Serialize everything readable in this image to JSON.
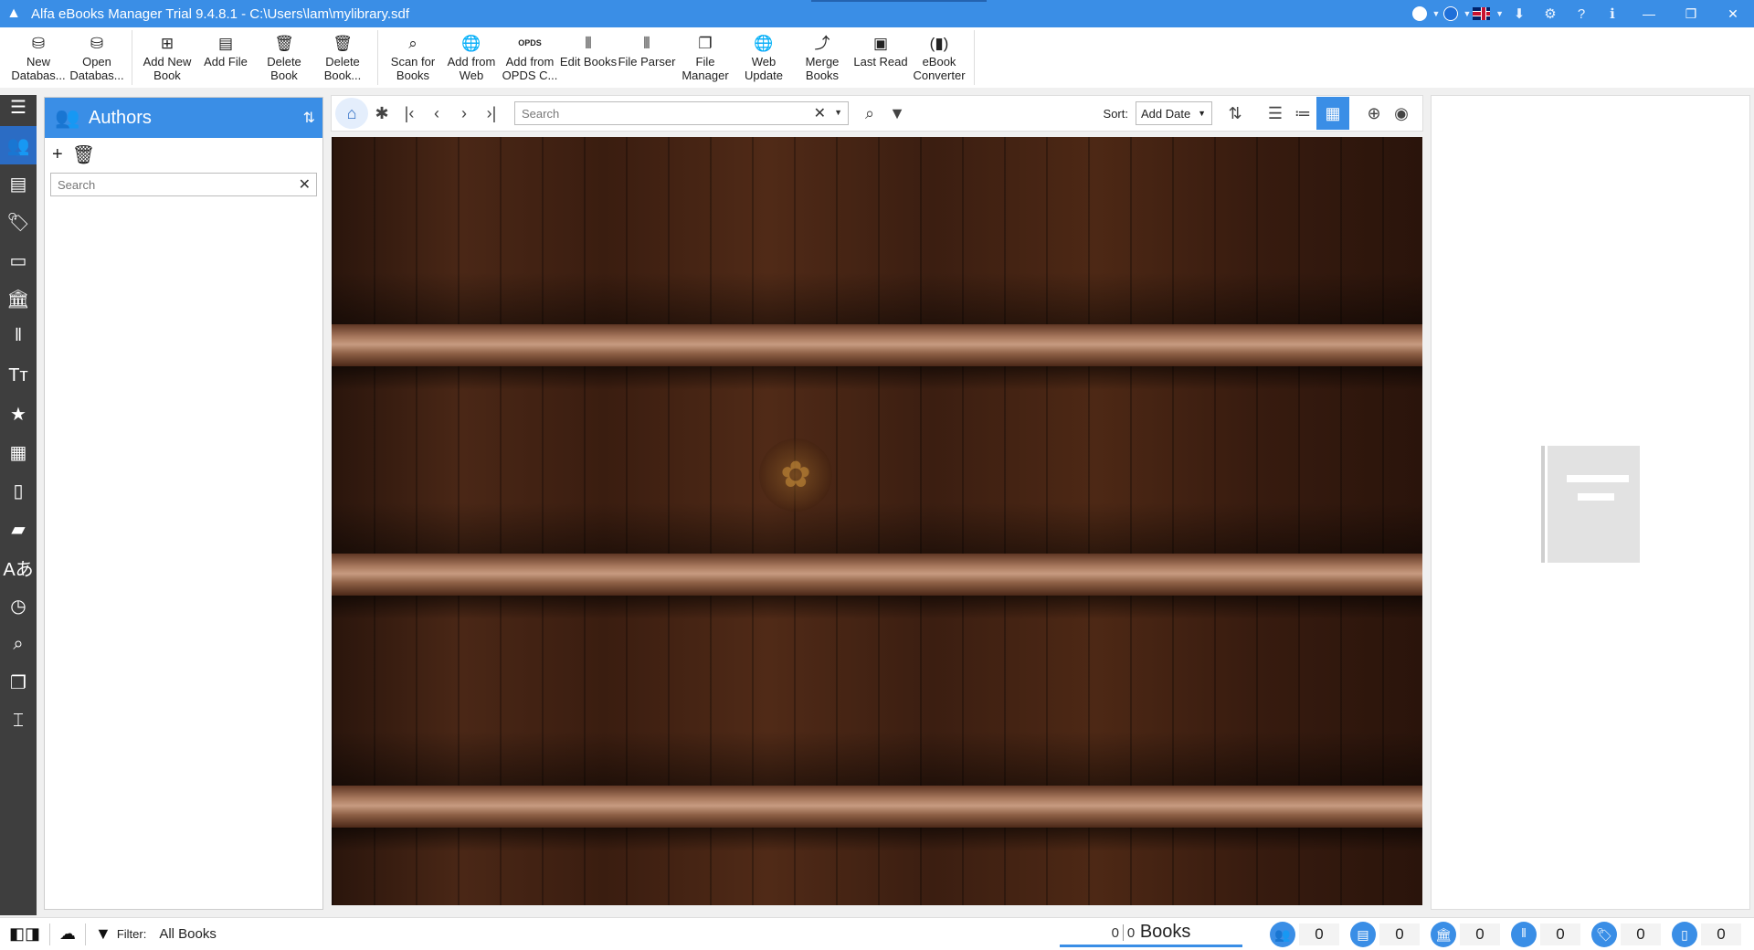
{
  "titlebar": {
    "title": "Alfa eBooks Manager Trial 9.4.8.1 - C:\\Users\\lam\\mylibrary.sdf"
  },
  "ribbon": {
    "groups": [
      [
        {
          "label": "New Databas...",
          "icon": "new-database-icon",
          "glyph": "⛁"
        },
        {
          "label": "Open Databas...",
          "icon": "open-database-icon",
          "glyph": "⛁"
        }
      ],
      [
        {
          "label": "Add New Book",
          "icon": "add-book-icon",
          "glyph": "⊞"
        },
        {
          "label": "Add File",
          "icon": "add-file-icon",
          "glyph": "▤"
        },
        {
          "label": "Delete Book",
          "icon": "delete-book-icon",
          "glyph": "🗑"
        },
        {
          "label": "Delete Book...",
          "icon": "delete-book-file-icon",
          "glyph": "🗑"
        }
      ],
      [
        {
          "label": "Scan for Books",
          "icon": "scan-icon",
          "glyph": "⌕"
        },
        {
          "label": "Add from Web",
          "icon": "globe-icon",
          "glyph": "🌐"
        },
        {
          "label": "Add from OPDS C...",
          "icon": "opds-icon",
          "glyph": "OPDS"
        },
        {
          "label": "Edit Books",
          "icon": "edit-books-icon",
          "glyph": "⦀"
        },
        {
          "label": "File Parser",
          "icon": "barcode-icon",
          "glyph": "⦀"
        },
        {
          "label": "File Manager",
          "icon": "file-manager-icon",
          "glyph": "❐"
        },
        {
          "label": "Web Update",
          "icon": "web-update-icon",
          "glyph": "🌐"
        },
        {
          "label": "Merge Books",
          "icon": "merge-icon",
          "glyph": "⤴"
        },
        {
          "label": "Last Read",
          "icon": "book-open-icon",
          "glyph": "▣"
        },
        {
          "label": "eBook Converter",
          "icon": "converter-icon",
          "glyph": "(▮)"
        }
      ]
    ]
  },
  "leftnav": {
    "items": [
      {
        "icon": "menu-icon",
        "glyph": "☰"
      },
      {
        "icon": "authors-icon",
        "glyph": "👥"
      },
      {
        "icon": "series-icon",
        "glyph": "▤"
      },
      {
        "icon": "tags-icon",
        "glyph": "🏷"
      },
      {
        "icon": "monitor-icon",
        "glyph": "▭"
      },
      {
        "icon": "library-icon",
        "glyph": "🏛"
      },
      {
        "icon": "bookshelf-icon",
        "glyph": "𝍪"
      },
      {
        "icon": "text-icon",
        "glyph": "Tт"
      },
      {
        "icon": "star-icon",
        "glyph": "★"
      },
      {
        "icon": "calendar-icon",
        "glyph": "▦"
      },
      {
        "icon": "document-icon",
        "glyph": "▯"
      },
      {
        "icon": "book-icon",
        "glyph": "▰"
      },
      {
        "icon": "translate-icon",
        "glyph": "Aあ"
      },
      {
        "icon": "calendar-clock-icon",
        "glyph": "◷"
      },
      {
        "icon": "search-database-icon",
        "glyph": "⌕"
      },
      {
        "icon": "copy-icon",
        "glyph": "❐"
      },
      {
        "icon": "text-cursor-icon",
        "glyph": "⌶"
      }
    ]
  },
  "authors": {
    "title": "Authors",
    "search_placeholder": "Search"
  },
  "maintoolbar": {
    "search_placeholder": "Search",
    "sort_label": "Sort:",
    "sort_value": "Add Date"
  },
  "statusbar": {
    "filter_label": "Filter:",
    "filter_value": "All Books",
    "selected_count": "0",
    "total_count": "0",
    "books_label": "Books",
    "counters": [
      {
        "icon": "authors-count-icon",
        "glyph": "👥",
        "value": "0"
      },
      {
        "icon": "series-count-icon",
        "glyph": "▤",
        "value": "0"
      },
      {
        "icon": "publishers-count-icon",
        "glyph": "🏛",
        "value": "0"
      },
      {
        "icon": "bookshelves-count-icon",
        "glyph": "𝍪",
        "value": "0"
      },
      {
        "icon": "tags-count-icon",
        "glyph": "🏷",
        "value": "0"
      },
      {
        "icon": "files-count-icon",
        "glyph": "▯",
        "value": "0"
      }
    ]
  },
  "colors": {
    "accent": "#3a8ee6",
    "nav_bg": "#3e3e3e",
    "shelf_wood": "#4a2716"
  }
}
